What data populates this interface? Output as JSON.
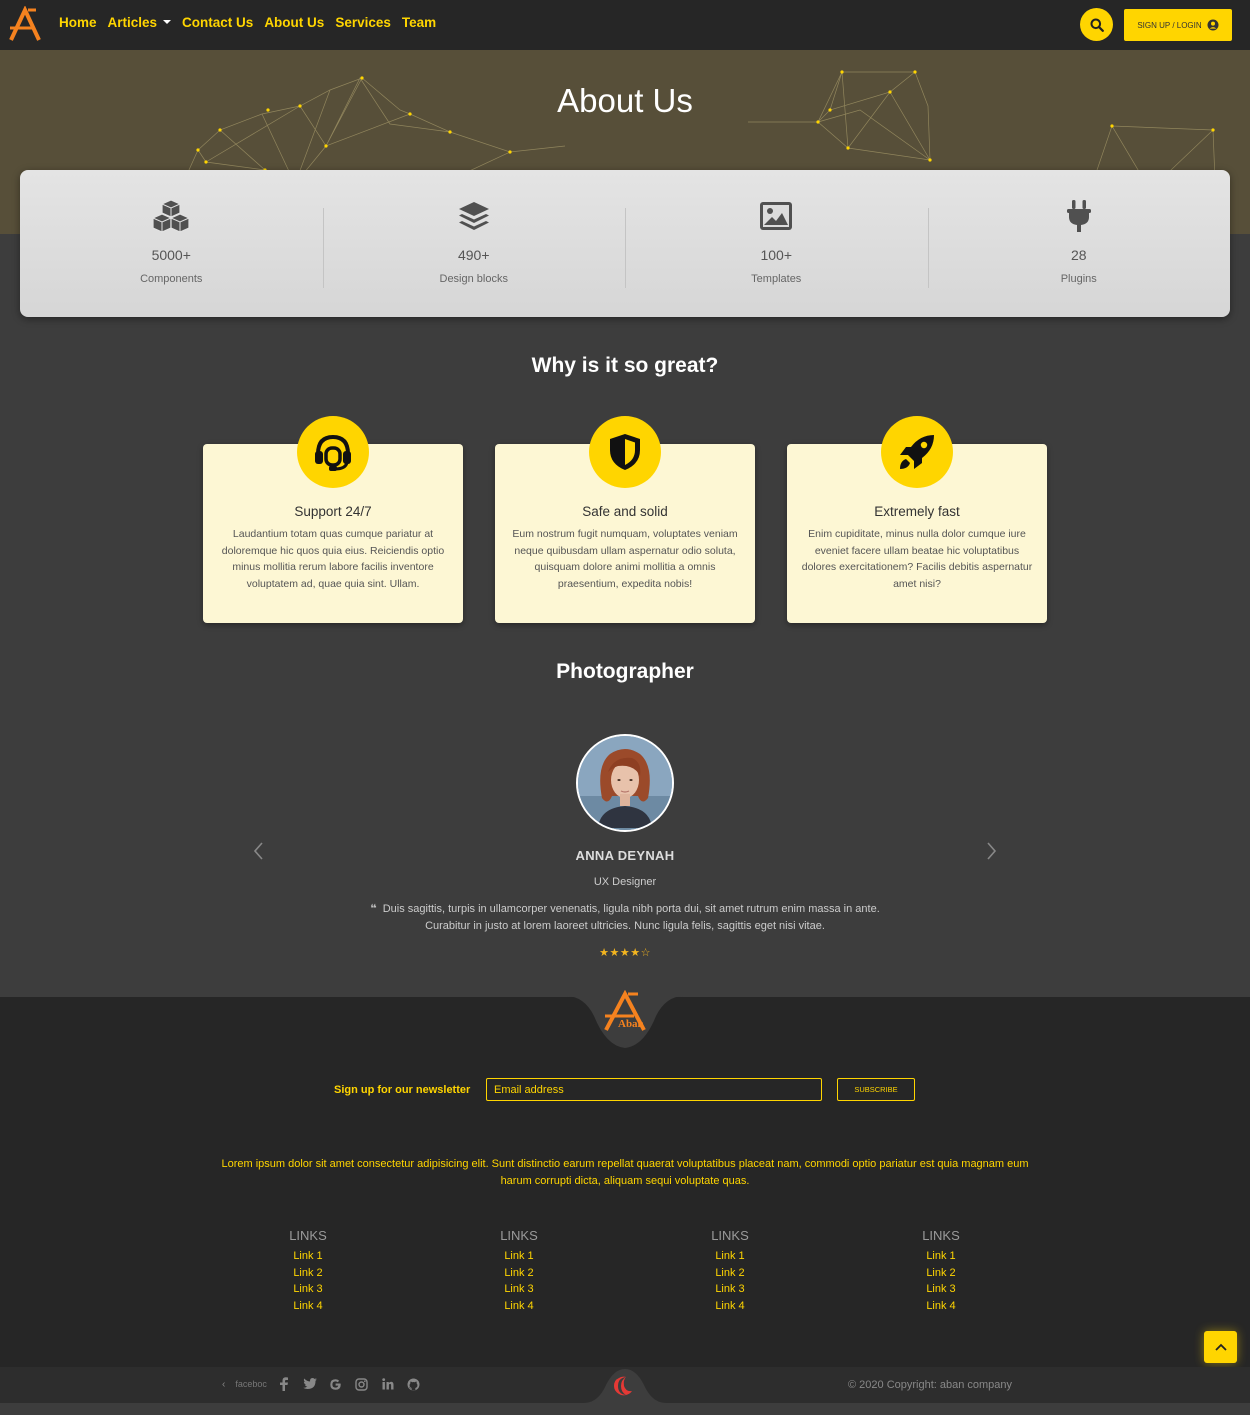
{
  "nav": {
    "links": [
      "Home",
      "Articles",
      "Contact Us",
      "About Us",
      "Services",
      "Team"
    ],
    "login_label": "SIGN UP / LOGIN"
  },
  "hero": {
    "title": "About Us"
  },
  "stats": [
    {
      "icon": "cubes-icon",
      "value": "5000+",
      "label": "Components"
    },
    {
      "icon": "layers-icon",
      "value": "490+",
      "label": "Design blocks"
    },
    {
      "icon": "image-icon",
      "value": "100+",
      "label": "Templates"
    },
    {
      "icon": "plug-icon",
      "value": "28",
      "label": "Plugins"
    }
  ],
  "features": {
    "title": "Why is it so great?",
    "cards": [
      {
        "icon": "headset-icon",
        "title": "Support 24/7",
        "text": "Laudantium totam quas cumque pariatur at doloremque hic quos quia eius. Reiciendis optio minus mollitia rerum labore facilis inventore voluptatem ad, quae quia sint. Ullam."
      },
      {
        "icon": "shield-icon",
        "title": "Safe and solid",
        "text": "Eum nostrum fugit numquam, voluptates veniam neque quibusdam ullam aspernatur odio soluta, quisquam dolore animi mollitia a omnis praesentium, expedita nobis!"
      },
      {
        "icon": "rocket-icon",
        "title": "Extremely fast",
        "text": "Enim cupiditate, minus nulla dolor cumque iure eveniet facere ullam beatae hic voluptatibus dolores exercitationem? Facilis debitis aspernatur amet nisi?"
      }
    ]
  },
  "testimonial": {
    "section_title": "Photographer",
    "name": "ANNA DEYNAH",
    "role": "UX Designer",
    "quote": "Duis sagittis, turpis in ullamcorper venenatis, ligula nibh porta dui, sit amet rutrum enim massa in ante. Curabitur in justo at lorem laoreet ultricies. Nunc ligula felis, sagittis eget nisi vitae.",
    "rating": 4,
    "rating_max": 5
  },
  "footer": {
    "logo_text": "Aban",
    "newsletter_label": "Sign up for our newsletter",
    "email_placeholder": "Email address",
    "subscribe_label": "SUBSCRIBE",
    "text": "Lorem ipsum dolor sit amet consectetur adipisicing elit. Sunt distinctio earum repellat quaerat voluptatibus placeat nam, commodi optio pariatur est quia magnam eum harum corrupti dicta, aliquam sequi voluptate quas.",
    "link_columns": [
      {
        "title": "LINKS",
        "links": [
          "Link 1",
          "Link 2",
          "Link 3",
          "Link 4"
        ]
      },
      {
        "title": "LINKS",
        "links": [
          "Link 1",
          "Link 2",
          "Link 3",
          "Link 4"
        ]
      },
      {
        "title": "LINKS",
        "links": [
          "Link 1",
          "Link 2",
          "Link 3",
          "Link 4"
        ]
      },
      {
        "title": "LINKS",
        "links": [
          "Link 1",
          "Link 2",
          "Link 3",
          "Link 4"
        ]
      }
    ]
  },
  "bottom": {
    "social_label": "faceboc",
    "social_icons": [
      "facebook-icon",
      "twitter-icon",
      "google-icon",
      "instagram-icon",
      "linkedin-icon",
      "github-icon"
    ],
    "copyright": "© 2020 Copyright: aban company"
  },
  "colors": {
    "accent": "#ffd500",
    "nav_bg": "#262626",
    "body_bg": "#3d3d3d",
    "hero_bg": "#574f39",
    "card_bg": "#fdf7d4",
    "logo": "#f5821f",
    "moon": "#e53935"
  }
}
